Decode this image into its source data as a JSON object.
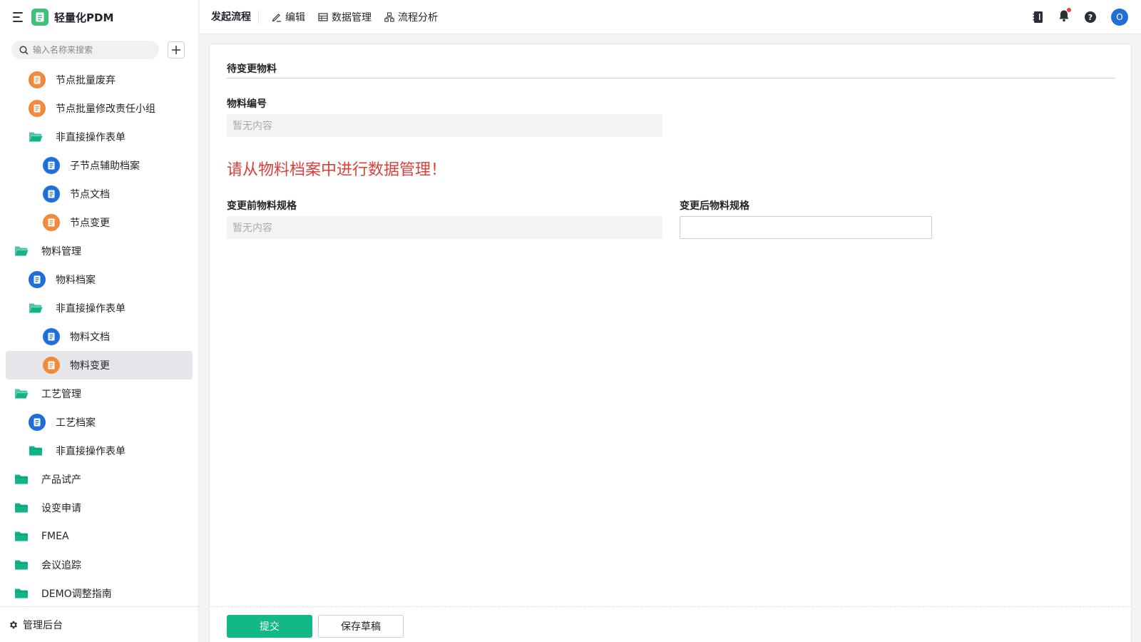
{
  "app": {
    "title": "轻量化PDM"
  },
  "search": {
    "placeholder": "输入名称来搜索"
  },
  "tree": [
    {
      "label": "节点批量废弃",
      "type": "doc",
      "color": "orange",
      "indent": 40
    },
    {
      "label": "节点批量修改责任小组",
      "type": "doc",
      "color": "orange",
      "indent": 40
    },
    {
      "label": "非直接操作表单",
      "type": "folder-open",
      "indent": 40
    },
    {
      "label": "子节点辅助档案",
      "type": "doc",
      "color": "blue",
      "indent": 60
    },
    {
      "label": "节点文档",
      "type": "doc",
      "color": "blue",
      "indent": 60
    },
    {
      "label": "节点变更",
      "type": "doc",
      "color": "orange",
      "indent": 60
    },
    {
      "label": "物料管理",
      "type": "folder-open",
      "indent": 20
    },
    {
      "label": "物料档案",
      "type": "doc",
      "color": "blue",
      "indent": 40
    },
    {
      "label": "非直接操作表单",
      "type": "folder-open",
      "indent": 40
    },
    {
      "label": "物料文档",
      "type": "doc",
      "color": "blue",
      "indent": 60
    },
    {
      "label": "物料变更",
      "type": "doc",
      "color": "orange",
      "indent": 60,
      "selected": true
    },
    {
      "label": "工艺管理",
      "type": "folder-open",
      "indent": 20
    },
    {
      "label": "工艺档案",
      "type": "doc",
      "color": "blue",
      "indent": 40
    },
    {
      "label": "非直接操作表单",
      "type": "folder",
      "indent": 40
    },
    {
      "label": "产品试产",
      "type": "folder",
      "indent": 20
    },
    {
      "label": "设变申请",
      "type": "folder",
      "indent": 20
    },
    {
      "label": "FMEA",
      "type": "folder",
      "indent": 20
    },
    {
      "label": "会议追踪",
      "type": "folder",
      "indent": 20
    },
    {
      "label": "DEMO调整指南",
      "type": "folder",
      "indent": 20
    }
  ],
  "sidebar_footer": {
    "label": "管理后台"
  },
  "topbar": {
    "title": "发起流程",
    "items": [
      {
        "label": "编辑",
        "icon": "pencil-icon"
      },
      {
        "label": "数据管理",
        "icon": "table-icon"
      },
      {
        "label": "流程分析",
        "icon": "flow-icon"
      }
    ],
    "avatar": "O"
  },
  "form": {
    "section_title": "待变更物料",
    "material_code_label": "物料编号",
    "material_code_value": "暂无内容",
    "notice": "请从物料档案中进行数据管理！",
    "spec_before_label": "变更前物料规格",
    "spec_before_value": "暂无内容",
    "spec_after_label": "变更后物料规格",
    "spec_after_value": ""
  },
  "buttons": {
    "submit": "提交",
    "save_draft": "保存草稿"
  },
  "colors": {
    "primary": "#12b886",
    "orange": "#f08a3c",
    "blue": "#1f6fd6",
    "folder": "#14b38a",
    "notice": "#d8413c"
  }
}
